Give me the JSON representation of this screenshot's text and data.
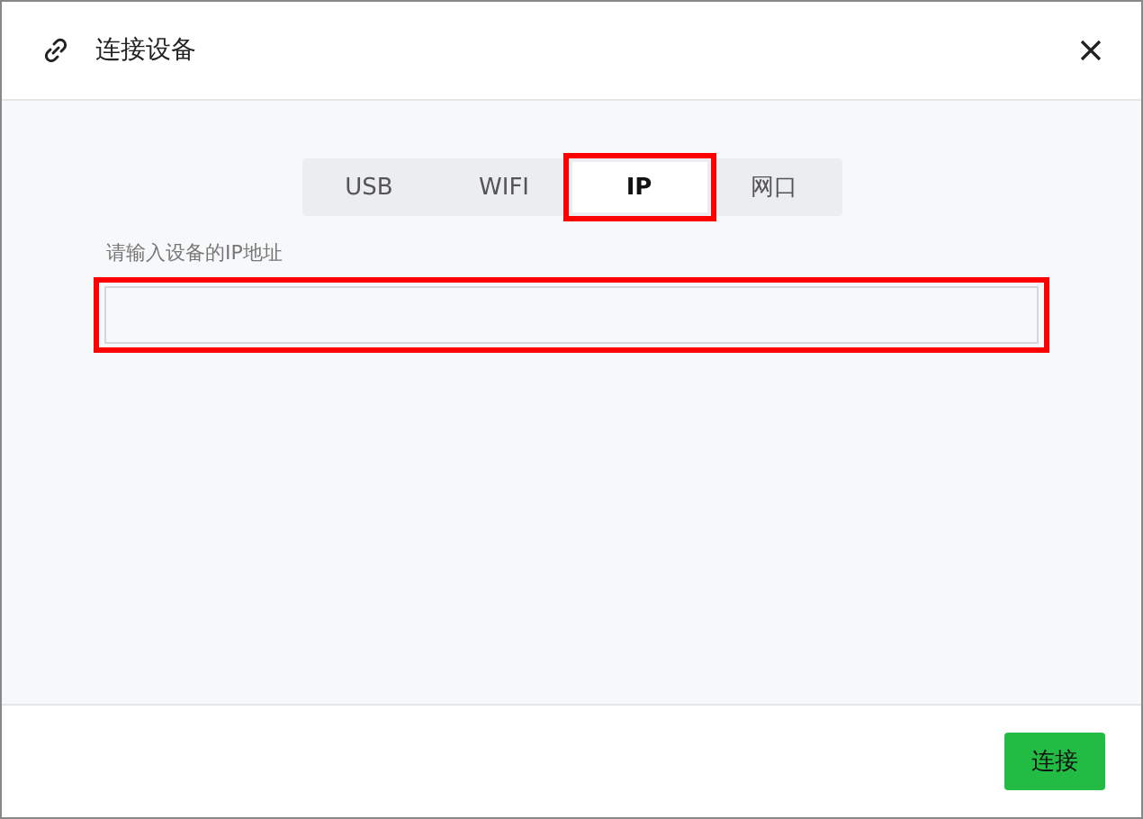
{
  "window": {
    "title": "连接设备"
  },
  "tabs": [
    {
      "label": "USB",
      "selected": false,
      "highlighted": false
    },
    {
      "label": "WIFI",
      "selected": false,
      "highlighted": false
    },
    {
      "label": "IP",
      "selected": true,
      "highlighted": true
    },
    {
      "label": "网口",
      "selected": false,
      "highlighted": false
    }
  ],
  "field": {
    "label": "请输入设备的IP地址",
    "highlighted": true
  },
  "buttons": [
    {
      "label": "连接"
    }
  ]
}
